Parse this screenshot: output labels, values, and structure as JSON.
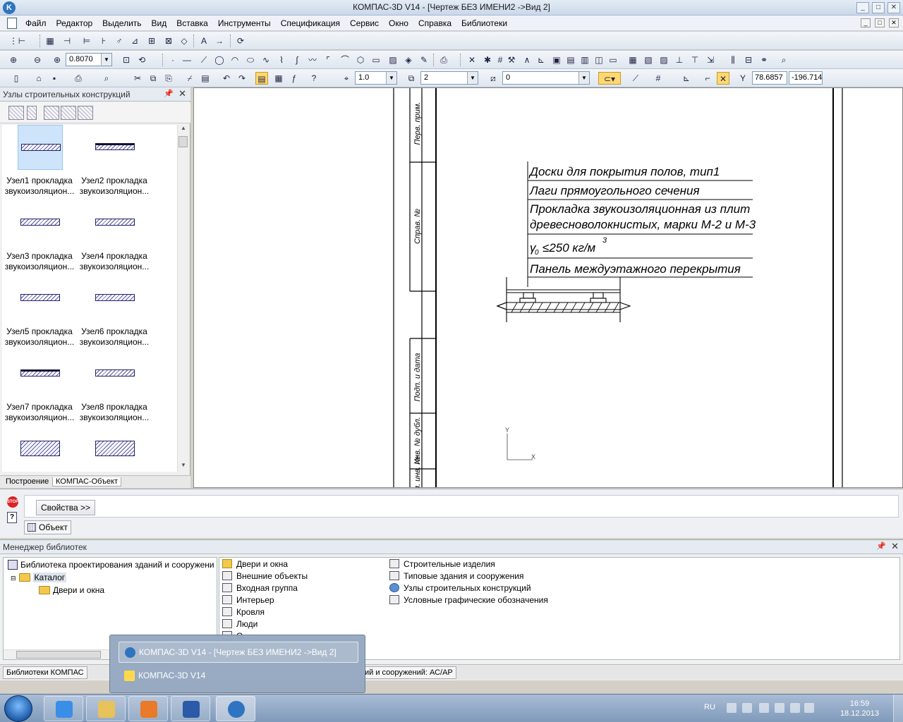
{
  "window": {
    "title": "КОМПАС-3D V14 - [Чертеж БЕЗ ИМЕНИ2 ->Вид 2]"
  },
  "menu": [
    "Файл",
    "Редактор",
    "Выделить",
    "Вид",
    "Вставка",
    "Инструменты",
    "Спецификация",
    "Сервис",
    "Окно",
    "Справка",
    "Библиотеки"
  ],
  "toolbar": {
    "zoom_value": "0.8070",
    "line_scale": "1.0",
    "layer_value": "2",
    "style_value": "0",
    "coord_x": "78.6857",
    "coord_y": "-196.714"
  },
  "left_panel": {
    "title": "Узлы строительных конструкций",
    "items": [
      {
        "line1": "Узел1 прокладка",
        "line2": "звукоизоляцион..."
      },
      {
        "line1": "Узел2 прокладка",
        "line2": "звукоизоляцион..."
      },
      {
        "line1": "Узел3 прокладка",
        "line2": "звукоизоляцион..."
      },
      {
        "line1": "Узел4 прокладка",
        "line2": "звукоизоляцион..."
      },
      {
        "line1": "Узел5 прокладка",
        "line2": "звукоизоляцион..."
      },
      {
        "line1": "Узел6 прокладка",
        "line2": "звукоизоляцион..."
      },
      {
        "line1": "Узел7 прокладка",
        "line2": "звукоизоляцион..."
      },
      {
        "line1": "Узел8 прокладка",
        "line2": "звукоизоляцион..."
      }
    ],
    "tabs": [
      "Построение",
      "КОМПАС-Объект"
    ]
  },
  "drawing": {
    "side_labels": [
      "Перв. прим.",
      "Справ. №",
      "Подп. и дата",
      "Инв. № дубл.",
      "Взам. инв. №"
    ],
    "leader_lines": [
      "Доски для покрытия полов, тип1",
      "Лаги прямоугольного сечения",
      "Прокладка звукоизоляционная из плит",
      "древесноволокнистых, марки М-2 и М-3",
      "γ",
      "0",
      "≤250 кг/м",
      "3",
      "Панель междуэтажного перекрытия"
    ],
    "axis_y": "Y",
    "axis_x": "X"
  },
  "properties": {
    "props_button": "Свойства  >>",
    "object_tab": "Объект",
    "stop_text": "STOP",
    "help_text": "?"
  },
  "library_manager": {
    "title": "Менеджер библиотек",
    "tree": {
      "root": "Библиотека проектирования зданий и сооружени",
      "catalog": "Каталог",
      "child": "Двери и окна"
    },
    "items_col1": [
      "Двери и окна",
      "Внешние объекты",
      "Входная группа",
      "Интерьер",
      "Кровля",
      "Люди",
      "О..."
    ],
    "items_col2": [
      "Строительные изделия",
      "Типовые здания и сооружения",
      "Узлы строительных конструкций",
      "Условные графические обозначения"
    ],
    "tabs": [
      "Библиотеки КОМПАС",
      "ий и сооружений: АС/АР"
    ]
  },
  "taskbar_popup": {
    "item1": "КОМПАС-3D V14 - [Чертеж БЕЗ ИМЕНИ2 ->Вид 2]",
    "item2": "КОМПАС-3D V14"
  },
  "tray": {
    "lang": "RU",
    "time": "16:59",
    "date": "18.12.2013"
  }
}
